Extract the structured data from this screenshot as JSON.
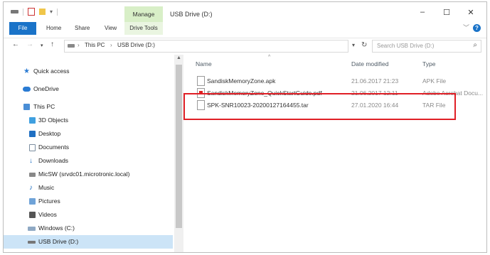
{
  "window": {
    "title": "USB Drive (D:)",
    "context_tab": "Manage",
    "controls": {
      "minimize": "–",
      "maximize": "☐",
      "close": "✕"
    }
  },
  "ribbon": {
    "tabs": [
      "File",
      "Home",
      "Share",
      "View",
      "Drive Tools"
    ],
    "help": "?"
  },
  "address": {
    "crumbs": [
      "This PC",
      "USB Drive (D:)"
    ],
    "search_placeholder": "Search USB Drive (D:)"
  },
  "nav": {
    "items": [
      {
        "label": "Quick access",
        "icon": "star-icon"
      },
      {
        "label": "OneDrive",
        "icon": "cloud-icon"
      },
      {
        "label": "This PC",
        "icon": "computer-icon"
      },
      {
        "label": "3D Objects",
        "icon": "cube-icon"
      },
      {
        "label": "Desktop",
        "icon": "desktop-icon"
      },
      {
        "label": "Documents",
        "icon": "documents-icon"
      },
      {
        "label": "Downloads",
        "icon": "downloads-icon"
      },
      {
        "label": "MicSW (srvdc01.microtronic.local)",
        "icon": "network-drive-icon"
      },
      {
        "label": "Music",
        "icon": "music-icon"
      },
      {
        "label": "Pictures",
        "icon": "pictures-icon"
      },
      {
        "label": "Videos",
        "icon": "videos-icon"
      },
      {
        "label": "Windows (C:)",
        "icon": "drive-icon"
      },
      {
        "label": "USB Drive (D:)",
        "icon": "usb-icon"
      }
    ]
  },
  "list": {
    "columns": [
      "Name",
      "Date modified",
      "Type"
    ],
    "files": [
      {
        "name": "SandiskMemoryZone.apk",
        "date": "21.06.2017 21:23",
        "type": "APK File"
      },
      {
        "name": "SandiskMemoryZone_QuickStartGuide.pdf",
        "date": "21.06.2017 12:11",
        "type": "Adobe Acrobat Docu..."
      },
      {
        "name": "SPK-SNR10023-20200127164455.tar",
        "date": "27.01.2020 16:44",
        "type": "TAR File"
      }
    ]
  },
  "colors": {
    "accent": "#1a73c8",
    "highlight": "#e01f26",
    "manage": "#d8efc7"
  }
}
